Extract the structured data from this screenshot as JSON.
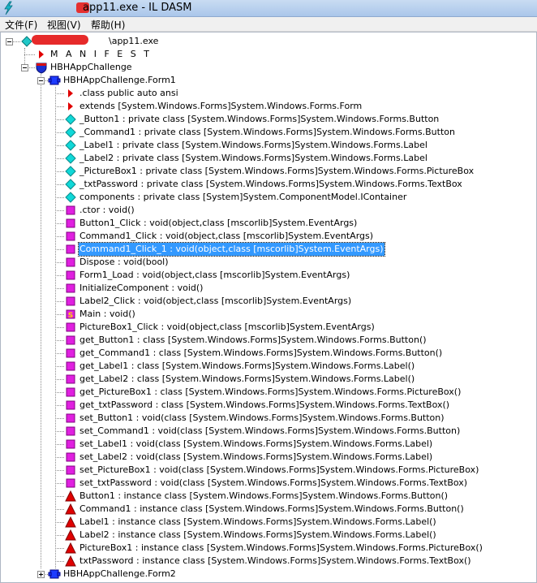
{
  "window": {
    "title": "app11.exe - IL DASM"
  },
  "menu": {
    "items": [
      {
        "label": "文件(F)"
      },
      {
        "label": "视图(V)"
      },
      {
        "label": "帮助(H)"
      }
    ]
  },
  "colors": {
    "selection": "#3399ff",
    "method": "#cc00cc",
    "field": "#00c0c0",
    "property": "#d00000",
    "titlebar": "#b8d1f0"
  },
  "tree": {
    "nodes": [
      {
        "label": "\\app11.exe",
        "icon": "assembly-icon",
        "level": 0,
        "expander": true
      },
      {
        "label": "M A N I F E S T",
        "icon": "manifest-arrow-icon",
        "level": 1
      },
      {
        "label": "HBHAppChallenge",
        "icon": "namespace-shield-icon",
        "level": 1,
        "expander": true
      },
      {
        "label": "HBHAppChallenge.Form1",
        "icon": "class-icon",
        "level": 2,
        "expander": true
      },
      {
        "label": ".class public auto ansi",
        "icon": "class-info-arrow-icon",
        "level": 3
      },
      {
        "label": "extends [System.Windows.Forms]System.Windows.Forms.Form",
        "icon": "class-info-arrow-icon",
        "level": 3
      },
      {
        "label": "_Button1 : private class [System.Windows.Forms]System.Windows.Forms.Button",
        "icon": "field-diamond-icon",
        "level": 3
      },
      {
        "label": "_Command1 : private class [System.Windows.Forms]System.Windows.Forms.Button",
        "icon": "field-diamond-icon",
        "level": 3
      },
      {
        "label": "_Label1 : private class [System.Windows.Forms]System.Windows.Forms.Label",
        "icon": "field-diamond-icon",
        "level": 3
      },
      {
        "label": "_Label2 : private class [System.Windows.Forms]System.Windows.Forms.Label",
        "icon": "field-diamond-icon",
        "level": 3
      },
      {
        "label": "_PictureBox1 : private class [System.Windows.Forms]System.Windows.Forms.PictureBox",
        "icon": "field-diamond-icon",
        "level": 3
      },
      {
        "label": "_txtPassword : private class [System.Windows.Forms]System.Windows.Forms.TextBox",
        "icon": "field-diamond-icon",
        "level": 3
      },
      {
        "label": "components : private class [System]System.ComponentModel.IContainer",
        "icon": "field-diamond-icon",
        "level": 3
      },
      {
        "label": ".ctor : void()",
        "icon": "method-icon",
        "level": 3
      },
      {
        "label": "Button1_Click : void(object,class [mscorlib]System.EventArgs)",
        "icon": "method-icon",
        "level": 3
      },
      {
        "label": "Command1_Click : void(object,class [mscorlib]System.EventArgs)",
        "icon": "method-icon",
        "level": 3
      },
      {
        "label": "Command1_Click_1 : void(object,class [mscorlib]System.EventArgs)",
        "icon": "method-icon",
        "level": 3,
        "selected": true
      },
      {
        "label": "Dispose : void(bool)",
        "icon": "method-icon",
        "level": 3
      },
      {
        "label": "Form1_Load : void(object,class [mscorlib]System.EventArgs)",
        "icon": "method-icon",
        "level": 3
      },
      {
        "label": "InitializeComponent : void()",
        "icon": "method-icon",
        "level": 3
      },
      {
        "label": "Label2_Click : void(object,class [mscorlib]System.EventArgs)",
        "icon": "method-icon",
        "level": 3
      },
      {
        "label": "Main : void()",
        "icon": "static-method-icon",
        "level": 3
      },
      {
        "label": "PictureBox1_Click : void(object,class [mscorlib]System.EventArgs)",
        "icon": "method-icon",
        "level": 3
      },
      {
        "label": "get_Button1 : class [System.Windows.Forms]System.Windows.Forms.Button()",
        "icon": "method-icon",
        "level": 3
      },
      {
        "label": "get_Command1 : class [System.Windows.Forms]System.Windows.Forms.Button()",
        "icon": "method-icon",
        "level": 3
      },
      {
        "label": "get_Label1 : class [System.Windows.Forms]System.Windows.Forms.Label()",
        "icon": "method-icon",
        "level": 3
      },
      {
        "label": "get_Label2 : class [System.Windows.Forms]System.Windows.Forms.Label()",
        "icon": "method-icon",
        "level": 3
      },
      {
        "label": "get_PictureBox1 : class [System.Windows.Forms]System.Windows.Forms.PictureBox()",
        "icon": "method-icon",
        "level": 3
      },
      {
        "label": "get_txtPassword : class [System.Windows.Forms]System.Windows.Forms.TextBox()",
        "icon": "method-icon",
        "level": 3
      },
      {
        "label": "set_Button1 : void(class [System.Windows.Forms]System.Windows.Forms.Button)",
        "icon": "method-icon",
        "level": 3
      },
      {
        "label": "set_Command1 : void(class [System.Windows.Forms]System.Windows.Forms.Button)",
        "icon": "method-icon",
        "level": 3
      },
      {
        "label": "set_Label1 : void(class [System.Windows.Forms]System.Windows.Forms.Label)",
        "icon": "method-icon",
        "level": 3
      },
      {
        "label": "set_Label2 : void(class [System.Windows.Forms]System.Windows.Forms.Label)",
        "icon": "method-icon",
        "level": 3
      },
      {
        "label": "set_PictureBox1 : void(class [System.Windows.Forms]System.Windows.Forms.PictureBox)",
        "icon": "method-icon",
        "level": 3
      },
      {
        "label": "set_txtPassword : void(class [System.Windows.Forms]System.Windows.Forms.TextBox)",
        "icon": "method-icon",
        "level": 3
      },
      {
        "label": "Button1 : instance class [System.Windows.Forms]System.Windows.Forms.Button()",
        "icon": "property-triangle-icon",
        "level": 3
      },
      {
        "label": "Command1 : instance class [System.Windows.Forms]System.Windows.Forms.Button()",
        "icon": "property-triangle-icon",
        "level": 3
      },
      {
        "label": "Label1 : instance class [System.Windows.Forms]System.Windows.Forms.Label()",
        "icon": "property-triangle-icon",
        "level": 3
      },
      {
        "label": "Label2 : instance class [System.Windows.Forms]System.Windows.Forms.Label()",
        "icon": "property-triangle-icon",
        "level": 3
      },
      {
        "label": "PictureBox1 : instance class [System.Windows.Forms]System.Windows.Forms.PictureBox()",
        "icon": "property-triangle-icon",
        "level": 3
      },
      {
        "label": "txtPassword : instance class [System.Windows.Forms]System.Windows.Forms.TextBox()",
        "icon": "property-triangle-icon",
        "level": 3
      },
      {
        "label": "HBHAppChallenge.Form2",
        "icon": "class-icon",
        "level": 2,
        "expander": true,
        "collapsed": true
      }
    ]
  }
}
